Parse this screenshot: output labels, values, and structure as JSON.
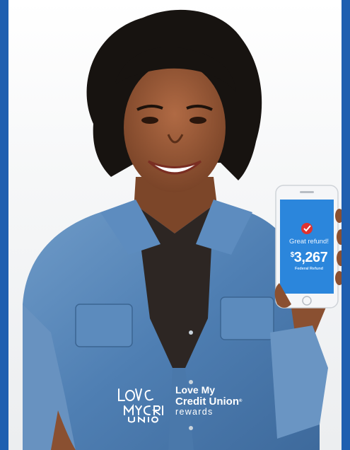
{
  "phone": {
    "title": "Great refund!",
    "currency": "$",
    "amount": "3,267",
    "caption": "Federal Refund"
  },
  "brand": {
    "logo_text": "LOVE MY CREDIT UNION",
    "line1": "Love My",
    "line2": "Credit Union",
    "reg": "®",
    "line3": "rewards"
  },
  "colors": {
    "border": "#1f5fb0",
    "phone_screen": "#2b86dc",
    "checkmark": "#e0322f",
    "shirt": "#4f7fb3"
  }
}
